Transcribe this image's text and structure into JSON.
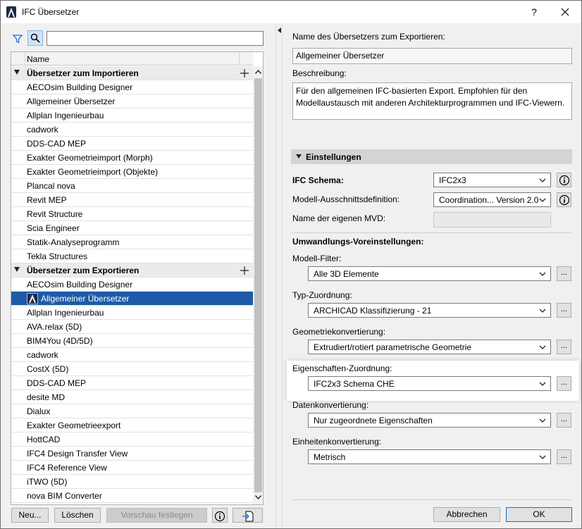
{
  "window": {
    "title": "IFC Übersetzer",
    "help_label": "?"
  },
  "left": {
    "search_placeholder": "",
    "list_header": "Name",
    "rows": [
      {
        "type": "group",
        "label": "Übersetzer zum Importieren"
      },
      {
        "type": "item",
        "label": "AECOsim Building Designer"
      },
      {
        "type": "item",
        "label": "Allgemeiner Übersetzer"
      },
      {
        "type": "item",
        "label": "Allplan Ingenieurbau"
      },
      {
        "type": "item",
        "label": "cadwork"
      },
      {
        "type": "item",
        "label": "DDS-CAD MEP"
      },
      {
        "type": "item",
        "label": "Exakter Geometrieimport (Morph)"
      },
      {
        "type": "item",
        "label": "Exakter Geometrieimport (Objekte)"
      },
      {
        "type": "item",
        "label": "Plancal nova"
      },
      {
        "type": "item",
        "label": "Revit MEP"
      },
      {
        "type": "item",
        "label": "Revit Structure"
      },
      {
        "type": "item",
        "label": "Scia Engineer"
      },
      {
        "type": "item",
        "label": "Statik-Analyseprogramm"
      },
      {
        "type": "item",
        "label": "Tekla Structures"
      },
      {
        "type": "group",
        "label": "Übersetzer zum Exportieren"
      },
      {
        "type": "item",
        "label": "AECOsim Building Designer"
      },
      {
        "type": "selected",
        "label": "Allgemeiner Übersetzer"
      },
      {
        "type": "item",
        "label": "Allplan Ingenieurbau"
      },
      {
        "type": "item",
        "label": "AVA.relax (5D)"
      },
      {
        "type": "item",
        "label": "BIM4You (4D/5D)"
      },
      {
        "type": "item",
        "label": "cadwork"
      },
      {
        "type": "item",
        "label": "CostX (5D)"
      },
      {
        "type": "item",
        "label": "DDS-CAD MEP"
      },
      {
        "type": "item",
        "label": "desite MD"
      },
      {
        "type": "item",
        "label": "Dialux"
      },
      {
        "type": "item",
        "label": "Exakter Geometrieexport"
      },
      {
        "type": "item",
        "label": "HottCAD"
      },
      {
        "type": "item",
        "label": "IFC4 Design Transfer View"
      },
      {
        "type": "item",
        "label": "IFC4 Reference View"
      },
      {
        "type": "item",
        "label": "iTWO (5D)"
      },
      {
        "type": "item",
        "label": "nova BIM Converter"
      }
    ],
    "buttons": {
      "new": "Neu...",
      "delete": "Löschen",
      "preview": "Vorschau festlegen"
    }
  },
  "right": {
    "name_label": "Name des Übersetzers zum Exportieren:",
    "name_value": "Allgemeiner Übersetzer",
    "desc_label": "Beschreibung:",
    "desc_value": "Für den allgemeinen IFC-basierten Export. Empfohlen für den Modellaustausch mit anderen Architekturprogrammen und IFC-Viewern.",
    "settings_header": "Einstellungen",
    "ifc_schema_label": "IFC Schema:",
    "ifc_schema_value": "IFC2x3",
    "mvd_label": "Modell-Ausschnittsdefinition:",
    "mvd_value": "Coordination... Version 2.0",
    "custom_mvd_label": "Name der eigenen MVD:",
    "custom_mvd_value": "",
    "conversion_header": "Umwandlungs-Voreinstellungen:",
    "model_filter_label": "Modell-Filter:",
    "model_filter_value": "Alle 3D Elemente",
    "type_map_label": "Typ-Zuordnung:",
    "type_map_value": "ARCHICAD Klassifizierung - 21",
    "geometry_label": "Geometriekonvertierung:",
    "geometry_value": "Extrudiert/rotiert parametrische Geometrie",
    "property_map_label": "Eigenschaften-Zuordnung:",
    "property_map_value": "IFC2x3 Schema CHE",
    "data_conv_label": "Datenkonvertierung:",
    "data_conv_value": "Nur zugeordnete Eigenschaften",
    "unit_conv_label": "Einheitenkonvertierung:",
    "unit_conv_value": "Metrisch",
    "dots_label": "...",
    "cancel_label": "Abbrechen",
    "ok_label": "OK"
  }
}
